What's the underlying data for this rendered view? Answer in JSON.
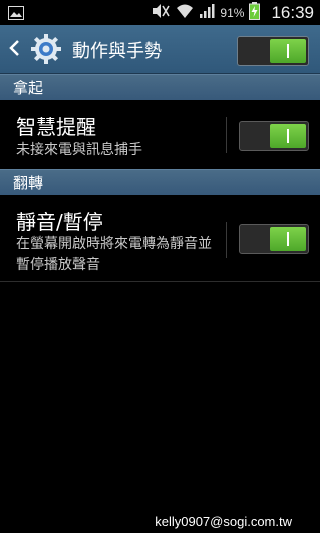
{
  "status_bar": {
    "battery_percent": "91%",
    "time": "16:39",
    "icons": [
      "image-icon",
      "mute-icon",
      "wifi-icon",
      "signal-icon",
      "battery-charging-icon"
    ]
  },
  "action_bar": {
    "title": "動作與手勢",
    "master_switch_on": true
  },
  "sections": [
    {
      "header": "拿起",
      "items": [
        {
          "title": "智慧提醒",
          "subtitle": "未接來電與訊息捕手",
          "enabled": true
        }
      ]
    },
    {
      "header": "翻轉",
      "items": [
        {
          "title": "靜音/暫停",
          "subtitle": "在螢幕開啟時將來電轉為靜音並暫停播放聲音",
          "enabled": true
        }
      ]
    }
  ],
  "watermark": "kelly0907@sogi.com.tw",
  "colors": {
    "action_bar": "#30587a",
    "switch_on": "#5cbc33",
    "background": "#000000"
  }
}
